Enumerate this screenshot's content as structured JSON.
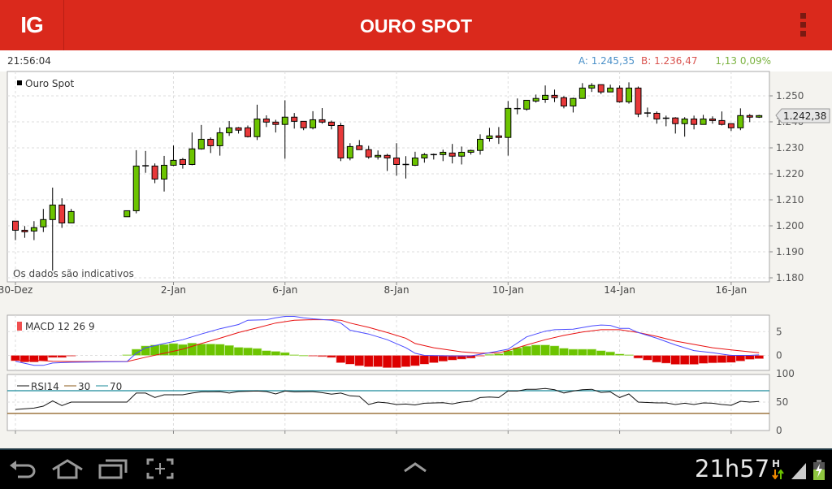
{
  "header": {
    "logo": "IG",
    "title": "OURO SPOT"
  },
  "info": {
    "time": "21:56:04",
    "ask": "A: 1.245,35",
    "bid": "B: 1.236,47",
    "change": "1,13 0,09%"
  },
  "colors": {
    "up": "#6cc400",
    "down": "#e8393a",
    "macd": "#4a4aff",
    "signal": "#e81010",
    "hist_up": "#6cc400",
    "hist_down": "#dd0000",
    "rsi": "#111111",
    "rsi30": "#8b5a1a",
    "rsi70": "#1a8a9a",
    "header": "#da291c"
  },
  "chart_data": {
    "type": "candlestick",
    "legend": "Ouro Spot",
    "note": "Os dados são indicativos",
    "current_price_label": "1.242,38",
    "current_price": 1.2424,
    "ylim": [
      1.178,
      1.258
    ],
    "y_ticks": [
      1.18,
      1.19,
      1.2,
      1.21,
      1.22,
      1.23,
      1.24,
      1.25
    ],
    "y_tick_labels": [
      "1.180",
      "1.190",
      "1.200",
      "1.210",
      "1.220",
      "1.230",
      "1.240",
      "1.250"
    ],
    "x_ticks": [
      {
        "i": 0,
        "label": "30-Dez"
      },
      {
        "i": 17,
        "label": "2-Jan"
      },
      {
        "i": 29,
        "label": "6-Jan"
      },
      {
        "i": 41,
        "label": "8-Jan"
      },
      {
        "i": 53,
        "label": "10-Jan"
      },
      {
        "i": 65,
        "label": "14-Jan"
      },
      {
        "i": 77,
        "label": "16-Jan"
      }
    ],
    "ohlc": [
      [
        1.2018,
        1.2018,
        1.1945,
        1.1983
      ],
      [
        1.1983,
        1.1999,
        1.1954,
        1.1977
      ],
      [
        1.198,
        1.2018,
        1.1945,
        1.1993
      ],
      [
        1.1996,
        1.2065,
        1.1976,
        1.2024
      ],
      [
        1.2024,
        1.2147,
        1.1827,
        1.208
      ],
      [
        1.208,
        1.2106,
        1.1992,
        1.2011
      ],
      [
        1.2011,
        1.2065,
        1.2011,
        1.2055
      ],
      null,
      null,
      null,
      null,
      null,
      [
        1.2035,
        1.2058,
        1.2035,
        1.2058
      ],
      [
        1.2058,
        1.2291,
        1.2048,
        1.223
      ],
      [
        1.223,
        1.2288,
        1.2204,
        1.2231
      ],
      [
        1.223,
        1.224,
        1.2164,
        1.218
      ],
      [
        1.218,
        1.2269,
        1.2132,
        1.2233
      ],
      [
        1.2233,
        1.2309,
        1.223,
        1.2252
      ],
      [
        1.2255,
        1.2261,
        1.222,
        1.2236
      ],
      [
        1.2236,
        1.2359,
        1.2233,
        1.2296
      ],
      [
        1.2296,
        1.2388,
        1.2293,
        1.2333
      ],
      [
        1.2333,
        1.234,
        1.228,
        1.2308
      ],
      [
        1.2308,
        1.2378,
        1.227,
        1.2358
      ],
      [
        1.2358,
        1.2403,
        1.2346,
        1.2377
      ],
      [
        1.2377,
        1.238,
        1.2355,
        1.2368
      ],
      [
        1.2377,
        1.2386,
        1.234,
        1.2343
      ],
      [
        1.2343,
        1.2466,
        1.233,
        1.2411
      ],
      [
        1.2411,
        1.2425,
        1.238,
        1.2399
      ],
      [
        1.2399,
        1.2408,
        1.2359,
        1.239
      ],
      [
        1.239,
        1.2483,
        1.2258,
        1.2418
      ],
      [
        1.2418,
        1.2434,
        1.2374,
        1.2402
      ],
      [
        1.2402,
        1.2402,
        1.2368,
        1.2377
      ],
      [
        1.2377,
        1.2441,
        1.2371,
        1.2408
      ],
      [
        1.2408,
        1.2453,
        1.2393,
        1.2399
      ],
      [
        1.2399,
        1.2405,
        1.2371,
        1.2386
      ],
      [
        1.2386,
        1.2396,
        1.2249,
        1.2261
      ],
      [
        1.2261,
        1.2318,
        1.2252,
        1.2305
      ],
      [
        1.2308,
        1.233,
        1.2293,
        1.2293
      ],
      [
        1.2293,
        1.2308,
        1.2258,
        1.2265
      ],
      [
        1.2265,
        1.229,
        1.2255,
        1.2271
      ],
      [
        1.2271,
        1.2277,
        1.2211,
        1.2261
      ],
      [
        1.2261,
        1.2318,
        1.2193,
        1.2236
      ],
      [
        1.2236,
        1.2268,
        1.2182,
        1.2235
      ],
      [
        1.2233,
        1.2285,
        1.223,
        1.2261
      ],
      [
        1.2261,
        1.228,
        1.2243,
        1.2274
      ],
      [
        1.2273,
        1.2278,
        1.2255,
        1.2274
      ],
      [
        1.2274,
        1.2293,
        1.2249,
        1.2283
      ],
      [
        1.228,
        1.2315,
        1.224,
        1.2268
      ],
      [
        1.2268,
        1.2305,
        1.2236,
        1.2283
      ],
      [
        1.2283,
        1.2293,
        1.2274,
        1.229
      ],
      [
        1.229,
        1.2352,
        1.2274,
        1.2333
      ],
      [
        1.2336,
        1.2377,
        1.2324,
        1.2346
      ],
      [
        1.2346,
        1.238,
        1.2315,
        1.234
      ],
      [
        1.234,
        1.248,
        1.227,
        1.2452
      ],
      [
        1.245,
        1.249,
        1.2429,
        1.2451
      ],
      [
        1.2449,
        1.2483,
        1.2443,
        1.2483
      ],
      [
        1.248,
        1.2505,
        1.2474,
        1.249
      ],
      [
        1.2486,
        1.254,
        1.2473,
        1.2502
      ],
      [
        1.2502,
        1.2524,
        1.2476,
        1.2493
      ],
      [
        1.2493,
        1.2499,
        1.2452,
        1.2461
      ],
      [
        1.2461,
        1.2493,
        1.2436,
        1.249
      ],
      [
        1.249,
        1.2549,
        1.249,
        1.253
      ],
      [
        1.253,
        1.2549,
        1.2515,
        1.254
      ],
      [
        1.2543,
        1.2543,
        1.2507,
        1.2515
      ],
      [
        1.2515,
        1.2543,
        1.2515,
        1.253
      ],
      [
        1.253,
        1.254,
        1.2474,
        1.2477
      ],
      [
        1.2477,
        1.2552,
        1.247,
        1.253
      ],
      [
        1.253,
        1.2536,
        1.2418,
        1.243
      ],
      [
        1.2433,
        1.2455,
        1.2418,
        1.2434
      ],
      [
        1.2433,
        1.244,
        1.2393,
        1.2411
      ],
      [
        1.2414,
        1.2424,
        1.2383,
        1.2413
      ],
      [
        1.2415,
        1.2418,
        1.2355,
        1.2393
      ],
      [
        1.2393,
        1.2418,
        1.2343,
        1.2411
      ],
      [
        1.2411,
        1.2424,
        1.2371,
        1.239
      ],
      [
        1.239,
        1.2427,
        1.239,
        1.2411
      ],
      [
        1.2411,
        1.2421,
        1.2393,
        1.2405
      ],
      [
        1.2405,
        1.244,
        1.2386,
        1.239
      ],
      [
        1.2393,
        1.2393,
        1.2365,
        1.2377
      ],
      [
        1.2377,
        1.2452,
        1.2368,
        1.2424
      ],
      [
        1.2424,
        1.243,
        1.2399,
        1.2418
      ],
      [
        1.2418,
        1.2427,
        1.2415,
        1.2424
      ]
    ],
    "macd": {
      "label": "MACD 12 26 9",
      "y_tick_labels": [
        "5",
        "0"
      ],
      "y_ticks": [
        5,
        0
      ],
      "histogram": [
        -1.15,
        -1.4,
        -1.4,
        -1.15,
        -0.45,
        -0.45,
        -0.1,
        null,
        null,
        null,
        null,
        null,
        0.15,
        1.3,
        2.0,
        2.2,
        2.3,
        2.5,
        2.3,
        2.6,
        2.4,
        2.4,
        2.35,
        2.1,
        1.7,
        1.6,
        1.45,
        1.0,
        0.85,
        0.6,
        0.15,
        0.02,
        -0.1,
        -0.25,
        -0.45,
        -1.55,
        -1.85,
        -2.2,
        -2.4,
        -2.4,
        -2.6,
        -2.6,
        -2.4,
        -2.2,
        -1.85,
        -1.55,
        -1.25,
        -1.0,
        -0.8,
        -0.6,
        -0.1,
        0.2,
        0.35,
        1.0,
        1.6,
        1.95,
        2.2,
        2.2,
        2.0,
        1.5,
        1.3,
        1.3,
        1.3,
        1.0,
        0.75,
        0.3,
        0.15,
        -0.6,
        -1.0,
        -1.45,
        -1.65,
        -1.9,
        -1.9,
        -1.9,
        -1.7,
        -1.6,
        -1.55,
        -1.5,
        -1.2,
        -0.85,
        -0.7
      ],
      "macd_line": [
        [
          0,
          -1.25
        ],
        [
          2,
          -2.1
        ],
        [
          3,
          -2.1
        ],
        [
          4,
          -1.6
        ],
        [
          6,
          -1.45
        ],
        [
          12,
          -1.3
        ],
        [
          13,
          0.45
        ],
        [
          14,
          1.6
        ],
        [
          16,
          2.5
        ],
        [
          18,
          3.3
        ],
        [
          20,
          4.5
        ],
        [
          22,
          5.6
        ],
        [
          24,
          6.5
        ],
        [
          25,
          7.4
        ],
        [
          27,
          7.5
        ],
        [
          28,
          7.9
        ],
        [
          29,
          8.2
        ],
        [
          30,
          8.2
        ],
        [
          31,
          7.9
        ],
        [
          32,
          7.7
        ],
        [
          34,
          7.4
        ],
        [
          35,
          6.8
        ],
        [
          36,
          5.3
        ],
        [
          38,
          4.5
        ],
        [
          40,
          3.3
        ],
        [
          42,
          1.6
        ],
        [
          43,
          0.45
        ],
        [
          44,
          0
        ],
        [
          47,
          -0.1
        ],
        [
          49,
          -0.1
        ],
        [
          51,
          0.55
        ],
        [
          53,
          1.3
        ],
        [
          54,
          2.6
        ],
        [
          55,
          3.9
        ],
        [
          57,
          5.1
        ],
        [
          58,
          5.4
        ],
        [
          60,
          5.5
        ],
        [
          62,
          6.2
        ],
        [
          63,
          6.4
        ],
        [
          64,
          6.3
        ],
        [
          65,
          5.7
        ],
        [
          66,
          5.7
        ],
        [
          67,
          4.8
        ],
        [
          69,
          3.6
        ],
        [
          71,
          2.2
        ],
        [
          73,
          1.0
        ],
        [
          75,
          0.55
        ],
        [
          77,
          0
        ],
        [
          79,
          0
        ],
        [
          80,
          0.1
        ]
      ],
      "signal_line": [
        [
          0,
          -1.0
        ],
        [
          2,
          -1.0
        ],
        [
          4,
          -1.25
        ],
        [
          6,
          -1.3
        ],
        [
          12,
          -1.3
        ],
        [
          14,
          -0.4
        ],
        [
          16,
          0.45
        ],
        [
          18,
          1.3
        ],
        [
          20,
          2.5
        ],
        [
          22,
          3.6
        ],
        [
          24,
          4.8
        ],
        [
          26,
          5.8
        ],
        [
          28,
          6.8
        ],
        [
          30,
          7.4
        ],
        [
          32,
          7.5
        ],
        [
          34,
          7.5
        ],
        [
          35,
          7.4
        ],
        [
          36,
          6.8
        ],
        [
          38,
          5.9
        ],
        [
          40,
          4.8
        ],
        [
          42,
          3.6
        ],
        [
          43,
          2.5
        ],
        [
          45,
          1.6
        ],
        [
          48,
          0.75
        ],
        [
          50,
          0.45
        ],
        [
          52,
          0.55
        ],
        [
          53,
          1.0
        ],
        [
          55,
          2.2
        ],
        [
          57,
          3.3
        ],
        [
          59,
          4.2
        ],
        [
          61,
          4.9
        ],
        [
          63,
          5.4
        ],
        [
          65,
          5.4
        ],
        [
          67,
          4.8
        ],
        [
          69,
          4.0
        ],
        [
          71,
          3.0
        ],
        [
          73,
          2.3
        ],
        [
          75,
          1.6
        ],
        [
          77,
          1.15
        ],
        [
          80,
          0.55
        ]
      ]
    },
    "rsi": {
      "label": "RSI14",
      "lower_label": "30",
      "upper_label": "70",
      "lower": 30,
      "upper": 70,
      "y_ticks": [
        100,
        50,
        0
      ],
      "y_tick_labels": [
        "100",
        "50",
        "0"
      ],
      "values": [
        [
          0,
          37
        ],
        [
          2,
          39.5
        ],
        [
          3,
          42.9
        ],
        [
          4,
          52
        ],
        [
          5,
          43.8
        ],
        [
          6,
          50
        ],
        [
          12,
          50
        ],
        [
          13,
          65.8
        ],
        [
          14,
          65.8
        ],
        [
          15,
          58.1
        ],
        [
          16,
          62.9
        ],
        [
          18,
          62.9
        ],
        [
          19,
          65.8
        ],
        [
          20,
          68
        ],
        [
          22,
          68.5
        ],
        [
          23,
          65.8
        ],
        [
          24,
          68.6
        ],
        [
          26,
          69.5
        ],
        [
          27,
          68.6
        ],
        [
          28,
          64.3
        ],
        [
          29,
          69.5
        ],
        [
          30,
          68
        ],
        [
          32,
          68.5
        ],
        [
          33,
          66.5
        ],
        [
          34,
          63.8
        ],
        [
          35,
          65.8
        ],
        [
          36,
          61
        ],
        [
          37,
          60
        ],
        [
          38,
          45.7
        ],
        [
          39,
          50
        ],
        [
          40,
          48.6
        ],
        [
          41,
          45.7
        ],
        [
          42,
          46.5
        ],
        [
          43,
          45
        ],
        [
          44,
          48
        ],
        [
          46,
          49
        ],
        [
          47,
          46.7
        ],
        [
          48,
          50
        ],
        [
          49,
          51.4
        ],
        [
          50,
          58
        ],
        [
          51,
          59
        ],
        [
          52,
          58
        ],
        [
          53,
          69.5
        ],
        [
          54,
          69.5
        ],
        [
          55,
          72.6
        ],
        [
          56,
          72.6
        ],
        [
          57,
          74
        ],
        [
          58,
          71.7
        ],
        [
          59,
          66
        ],
        [
          60,
          69.5
        ],
        [
          61,
          71.7
        ],
        [
          62,
          72.6
        ],
        [
          63,
          67
        ],
        [
          64,
          68
        ],
        [
          65,
          58
        ],
        [
          66,
          64.3
        ],
        [
          67,
          50
        ],
        [
          69,
          48.6
        ],
        [
          70,
          48.6
        ],
        [
          71,
          45.7
        ],
        [
          72,
          48
        ],
        [
          73,
          45.7
        ],
        [
          74,
          48.6
        ],
        [
          75,
          48
        ],
        [
          76,
          45.7
        ],
        [
          77,
          44.3
        ],
        [
          78,
          51.4
        ],
        [
          79,
          50
        ],
        [
          80,
          51
        ]
      ]
    }
  },
  "statusbar": {
    "time": "21h57",
    "network": "H"
  }
}
